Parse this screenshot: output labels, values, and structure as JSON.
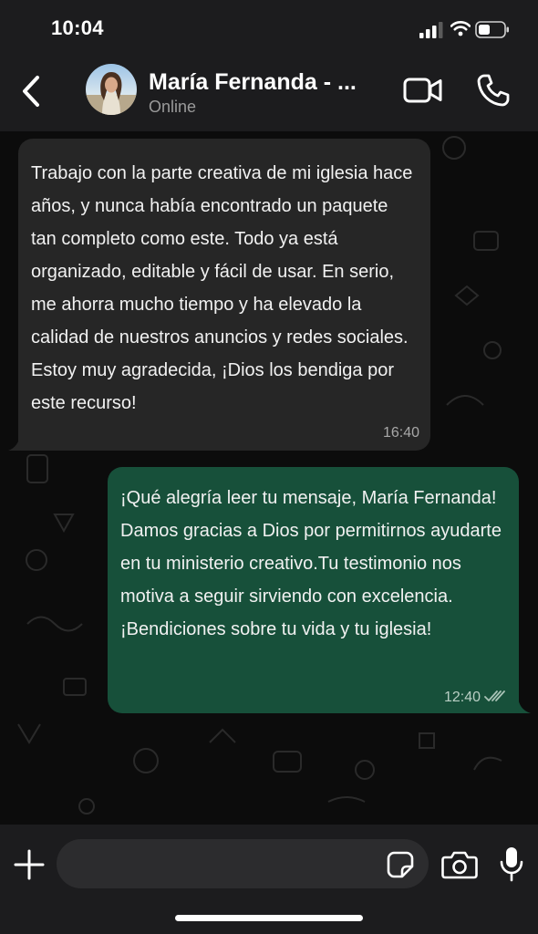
{
  "status_bar": {
    "time": "10:04",
    "signal_icon": "signal-bars-icon",
    "wifi_icon": "wifi-icon",
    "battery_icon": "battery-icon"
  },
  "header": {
    "contact_name": "María Fernanda - ...",
    "contact_status": "Online",
    "icons": [
      "back-chevron-icon",
      "video-camera-icon",
      "phone-icon"
    ]
  },
  "messages": [
    {
      "direction": "incoming",
      "text": "Trabajo con la parte creativa de mi iglesia hace años, y nunca había encontrado un paquete tan completo como este. Todo ya está organizado, editable y fácil de usar. En serio, me ahorra mucho tiempo y ha elevado la calidad de nuestros anuncios y redes sociales. Estoy muy agradecida, ¡Dios los bendiga por este recurso!",
      "time": "16:40"
    },
    {
      "direction": "outgoing",
      "text": "¡Qué alegría leer tu mensaje, María Fernanda! Damos gracias a Dios por permitirnos ayudarte en tu ministerio creativo.Tu testimonio nos motiva a seguir sirviendo con excelencia. ¡Bendiciones sobre tu vida y tu iglesia!",
      "time": "12:40",
      "status_icon": "double-check-icon"
    }
  ],
  "input_bar": {
    "placeholder": "",
    "icons": [
      "plus-icon",
      "sticker-icon",
      "camera-icon",
      "microphone-icon"
    ]
  },
  "colors": {
    "bar_background": "#1c1c1e",
    "chat_background": "#0c0c0c",
    "incoming_bubble": "#262626",
    "outgoing_bubble": "#17503a",
    "secondary_text": "#9a9a9a"
  }
}
